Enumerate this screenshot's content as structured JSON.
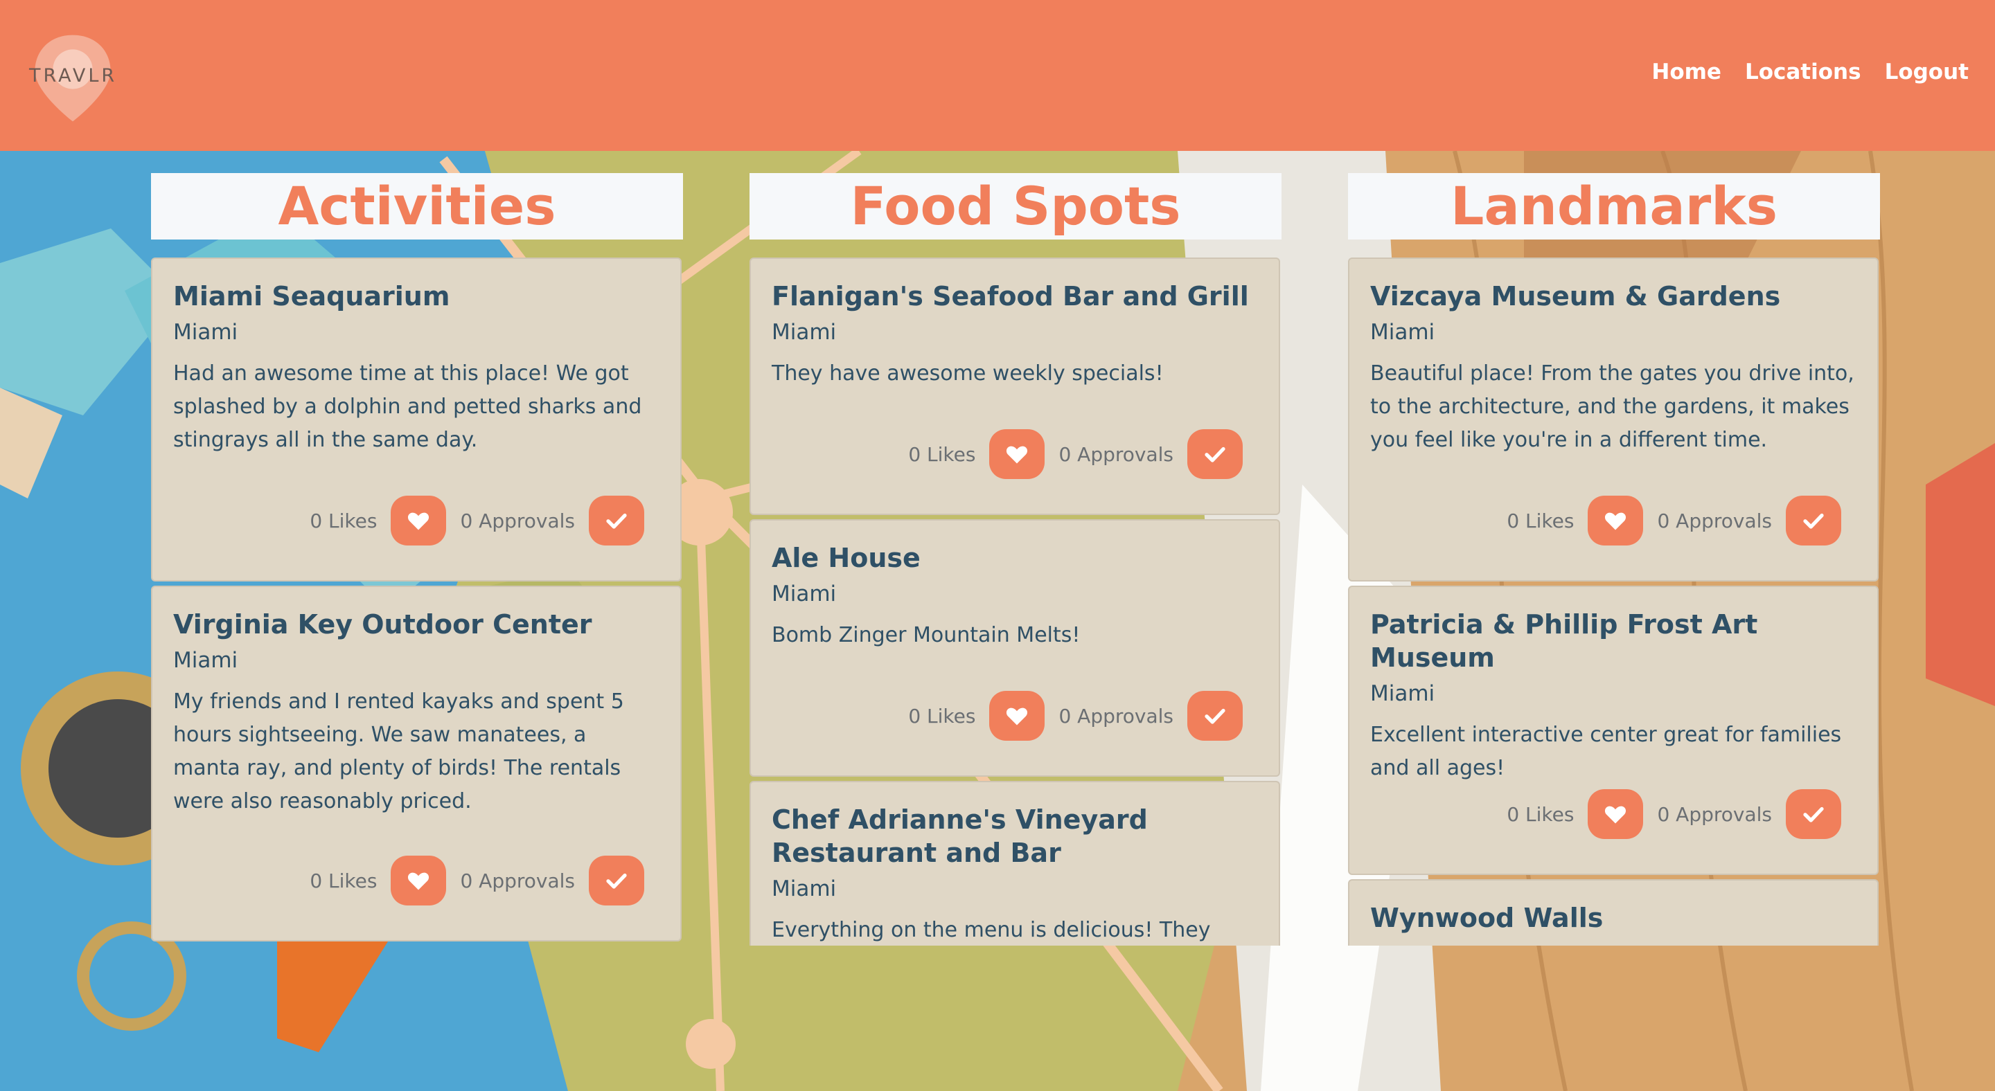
{
  "brand": {
    "name": "TRAVLR"
  },
  "nav": {
    "home": "Home",
    "locations": "Locations",
    "logout": "Logout"
  },
  "colors": {
    "accent": "#f17f5b",
    "card_bg": "#e0d7c6",
    "text": "#2f5066",
    "header_bg": "#f6f8fa"
  },
  "icons": {
    "like": "heart-icon",
    "approve": "checkmark-icon",
    "logo": "map-pin-icon"
  },
  "columns": [
    {
      "title": "Activities",
      "cards": [
        {
          "title": "Miami Seaquarium",
          "city": "Miami",
          "description": "Had an awesome time at this place! We got splashed by a dolphin and petted sharks and stingrays all in the same day.",
          "likes": "0 Likes",
          "approvals": "0 Approvals"
        },
        {
          "title": "Virginia Key Outdoor Center",
          "city": "Miami",
          "description": "My friends and I rented kayaks and spent 5 hours sightseeing. We saw manatees, a manta ray, and plenty of birds! The rentals were also reasonably priced.",
          "likes": "0 Likes",
          "approvals": "0 Approvals"
        }
      ]
    },
    {
      "title": "Food Spots",
      "cards": [
        {
          "title": "Flanigan's Seafood Bar and Grill",
          "city": "Miami",
          "description": "They have awesome weekly specials!",
          "likes": "0 Likes",
          "approvals": "0 Approvals"
        },
        {
          "title": "Ale House",
          "city": "Miami",
          "description": "Bomb Zinger Mountain Melts!",
          "likes": "0 Likes",
          "approvals": "0 Approvals"
        },
        {
          "title": "Chef Adrianne's Vineyard Restaurant and Bar",
          "city": "Miami",
          "description": "Everything on the menu is delicious! They also",
          "likes": "",
          "approvals": ""
        }
      ]
    },
    {
      "title": "Landmarks",
      "cards": [
        {
          "title": "Vizcaya Museum & Gardens",
          "city": "Miami",
          "description": "Beautiful place! From the gates you drive into, to the architecture, and the gardens, it makes you feel like you're in a different time.",
          "likes": "0 Likes",
          "approvals": "0 Approvals"
        },
        {
          "title": "Patricia & Phillip Frost Art Museum",
          "city": "Miami",
          "description": "Excellent interactive center great for families and all ages!",
          "likes": "0 Likes",
          "approvals": "0 Approvals"
        },
        {
          "title": "Wynwood Walls",
          "city": "",
          "description": "",
          "likes": "",
          "approvals": ""
        }
      ]
    }
  ]
}
